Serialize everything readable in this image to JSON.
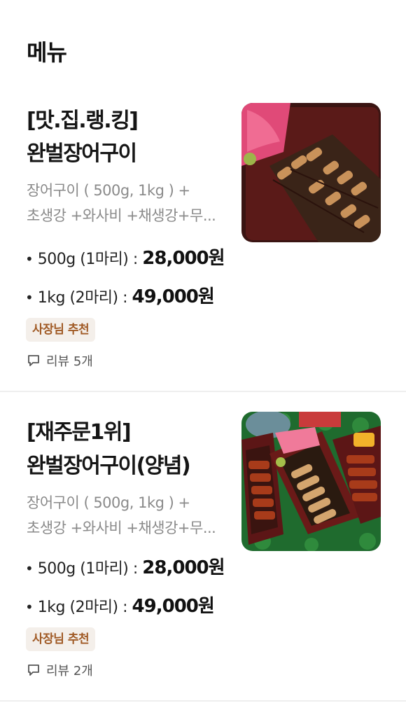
{
  "header": {
    "title": "메뉴"
  },
  "items": [
    {
      "title_line1": "[맛.집.랭.킹]",
      "title_line2": "완벌장어구이",
      "desc_line1": "장어구이 ( 500g, 1kg ) +",
      "desc_line2": "초생강 +와사비 +채생강+무...",
      "prices": [
        {
          "option": "500g (1마리) : ",
          "amount": "28,000원"
        },
        {
          "option": "1kg (2마리) : ",
          "amount": "49,000원"
        }
      ],
      "badge": "사장님 추천",
      "review": "리뷰 5개",
      "image_alt": "eel-box-photo"
    },
    {
      "title_line1": "[재주문1위]",
      "title_line2": "완벌장어구이(양념)",
      "desc_line1": "장어구이 ( 500g, 1kg ) +",
      "desc_line2": "초생강 +와사비 +채생강+무...",
      "prices": [
        {
          "option": "500g (1마리) : ",
          "amount": "28,000원"
        },
        {
          "option": "1kg (2마리) : ",
          "amount": "49,000원"
        }
      ],
      "badge": "사장님 추천",
      "review": "리뷰 2개",
      "image_alt": "seasoned-eel-box-photo"
    }
  ],
  "colors": {
    "badge_bg": "#f4efea",
    "badge_text": "#a05a25",
    "desc": "#8a8a8a",
    "divider": "#eeeeee"
  },
  "icons": {
    "review": "speech-bubble-icon"
  }
}
